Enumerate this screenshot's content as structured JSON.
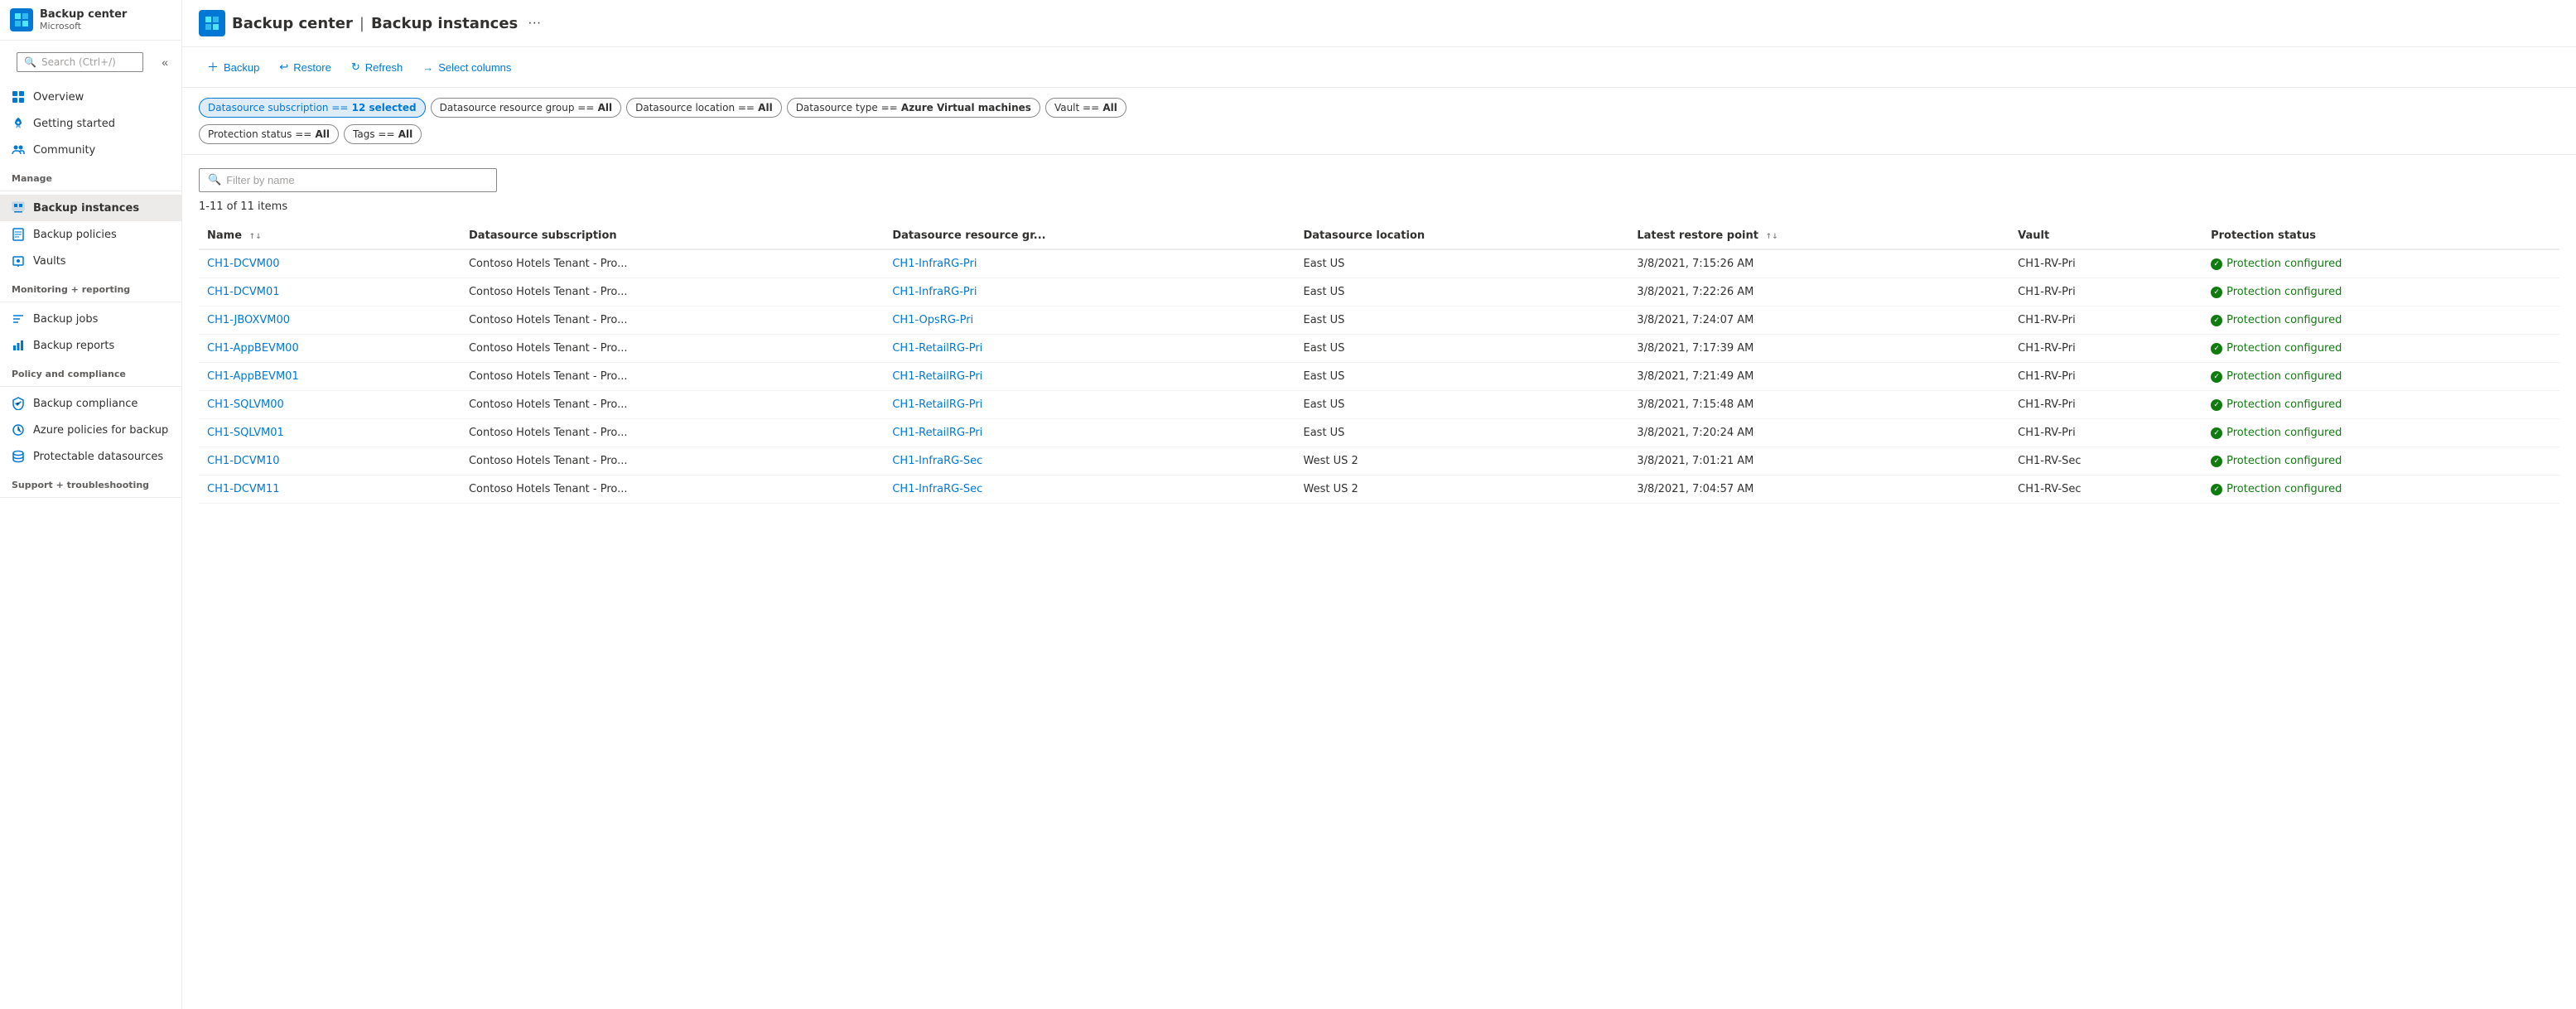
{
  "sidebar": {
    "logo_alt": "Backup center logo",
    "app_title": "Backup center",
    "breadcrumb_sep": "|",
    "page_name": "Backup instances",
    "microsoft_label": "Microsoft",
    "search_placeholder": "Search (Ctrl+/)",
    "collapse_label": "«",
    "nav": [
      {
        "id": "overview",
        "label": "Overview",
        "icon": "grid"
      },
      {
        "id": "getting-started",
        "label": "Getting started",
        "icon": "rocket"
      },
      {
        "id": "community",
        "label": "Community",
        "icon": "people"
      }
    ],
    "sections": [
      {
        "label": "Manage",
        "items": [
          {
            "id": "backup-instances",
            "label": "Backup instances",
            "icon": "instances",
            "active": true
          },
          {
            "id": "backup-policies",
            "label": "Backup policies",
            "icon": "policy"
          },
          {
            "id": "vaults",
            "label": "Vaults",
            "icon": "vault"
          }
        ]
      },
      {
        "label": "Monitoring + reporting",
        "items": [
          {
            "id": "backup-jobs",
            "label": "Backup jobs",
            "icon": "jobs"
          },
          {
            "id": "backup-reports",
            "label": "Backup reports",
            "icon": "reports"
          }
        ]
      },
      {
        "label": "Policy and compliance",
        "items": [
          {
            "id": "backup-compliance",
            "label": "Backup compliance",
            "icon": "compliance"
          },
          {
            "id": "azure-policies",
            "label": "Azure policies for backup",
            "icon": "azure-policy"
          },
          {
            "id": "protectable-datasources",
            "label": "Protectable datasources",
            "icon": "datasource"
          }
        ]
      },
      {
        "label": "Support + troubleshooting",
        "items": []
      }
    ]
  },
  "toolbar": {
    "backup_label": "Backup",
    "restore_label": "Restore",
    "refresh_label": "Refresh",
    "select_columns_label": "Select columns"
  },
  "filters": [
    {
      "id": "datasource-subscription",
      "text": "Datasource subscription == ",
      "value": "12 selected",
      "active": true
    },
    {
      "id": "datasource-resource-group",
      "text": "Datasource resource group == ",
      "value": "All",
      "active": false
    },
    {
      "id": "datasource-location",
      "text": "Datasource location == ",
      "value": "All",
      "active": false
    },
    {
      "id": "datasource-type",
      "text": "Datasource type == ",
      "value": "Azure Virtual machines",
      "active": false
    },
    {
      "id": "vault",
      "text": "Vault == ",
      "value": "All",
      "active": false
    },
    {
      "id": "protection-status",
      "text": "Protection status == ",
      "value": "All",
      "active": false
    },
    {
      "id": "tags",
      "text": "Tags == ",
      "value": "All",
      "active": false
    }
  ],
  "search": {
    "placeholder": "Filter by name"
  },
  "item_count": "1-11 of 11 items",
  "table": {
    "columns": [
      {
        "id": "name",
        "label": "Name",
        "sortable": true
      },
      {
        "id": "datasource-subscription",
        "label": "Datasource subscription",
        "sortable": false
      },
      {
        "id": "datasource-resource-group",
        "label": "Datasource resource gr...",
        "sortable": false
      },
      {
        "id": "datasource-location",
        "label": "Datasource location",
        "sortable": false
      },
      {
        "id": "latest-restore-point",
        "label": "Latest restore point",
        "sortable": true
      },
      {
        "id": "vault",
        "label": "Vault",
        "sortable": false
      },
      {
        "id": "protection-status",
        "label": "Protection status",
        "sortable": false
      }
    ],
    "rows": [
      {
        "name": "CH1-DCVM00",
        "subscription": "Contoso Hotels Tenant - Pro...",
        "resource_group": "CH1-InfraRG-Pri",
        "location": "East US",
        "restore_point": "3/8/2021, 7:15:26 AM",
        "vault": "CH1-RV-Pri",
        "status": "Protection configured"
      },
      {
        "name": "CH1-DCVM01",
        "subscription": "Contoso Hotels Tenant - Pro...",
        "resource_group": "CH1-InfraRG-Pri",
        "location": "East US",
        "restore_point": "3/8/2021, 7:22:26 AM",
        "vault": "CH1-RV-Pri",
        "status": "Protection configured"
      },
      {
        "name": "CH1-JBOXVM00",
        "subscription": "Contoso Hotels Tenant - Pro...",
        "resource_group": "CH1-OpsRG-Pri",
        "location": "East US",
        "restore_point": "3/8/2021, 7:24:07 AM",
        "vault": "CH1-RV-Pri",
        "status": "Protection configured"
      },
      {
        "name": "CH1-AppBEVM00",
        "subscription": "Contoso Hotels Tenant - Pro...",
        "resource_group": "CH1-RetailRG-Pri",
        "location": "East US",
        "restore_point": "3/8/2021, 7:17:39 AM",
        "vault": "CH1-RV-Pri",
        "status": "Protection configured"
      },
      {
        "name": "CH1-AppBEVM01",
        "subscription": "Contoso Hotels Tenant - Pro...",
        "resource_group": "CH1-RetailRG-Pri",
        "location": "East US",
        "restore_point": "3/8/2021, 7:21:49 AM",
        "vault": "CH1-RV-Pri",
        "status": "Protection configured"
      },
      {
        "name": "CH1-SQLVM00",
        "subscription": "Contoso Hotels Tenant - Pro...",
        "resource_group": "CH1-RetailRG-Pri",
        "location": "East US",
        "restore_point": "3/8/2021, 7:15:48 AM",
        "vault": "CH1-RV-Pri",
        "status": "Protection configured"
      },
      {
        "name": "CH1-SQLVM01",
        "subscription": "Contoso Hotels Tenant - Pro...",
        "resource_group": "CH1-RetailRG-Pri",
        "location": "East US",
        "restore_point": "3/8/2021, 7:20:24 AM",
        "vault": "CH1-RV-Pri",
        "status": "Protection configured"
      },
      {
        "name": "CH1-DCVM10",
        "subscription": "Contoso Hotels Tenant - Pro...",
        "resource_group": "CH1-InfraRG-Sec",
        "location": "West US 2",
        "restore_point": "3/8/2021, 7:01:21 AM",
        "vault": "CH1-RV-Sec",
        "status": "Protection configured"
      },
      {
        "name": "CH1-DCVM11",
        "subscription": "Contoso Hotels Tenant - Pro...",
        "resource_group": "CH1-InfraRG-Sec",
        "location": "West US 2",
        "restore_point": "3/8/2021, 7:04:57 AM",
        "vault": "CH1-RV-Sec",
        "status": "Protection configured"
      }
    ]
  }
}
